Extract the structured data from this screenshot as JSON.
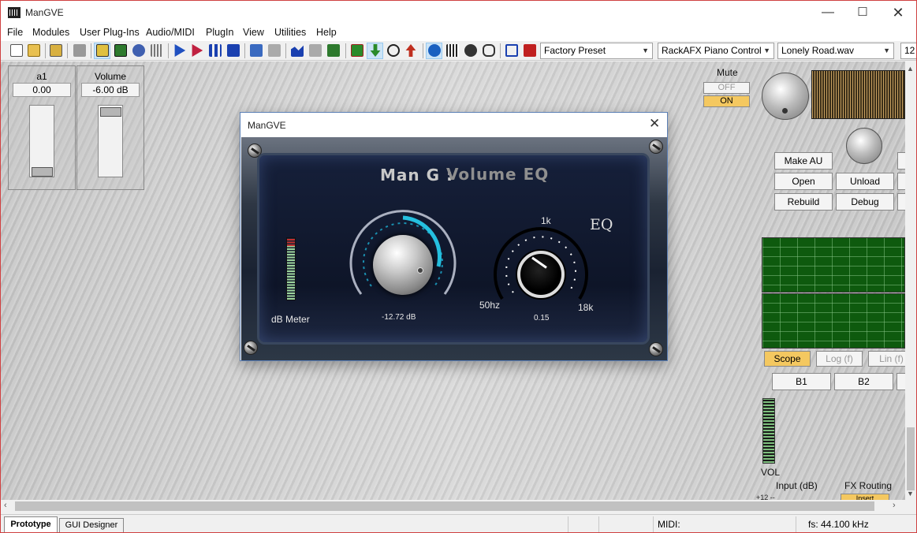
{
  "window": {
    "title": "ManGVE"
  },
  "menu": [
    "File",
    "Modules",
    "User Plug-Ins",
    "Audio/MIDI",
    "PlugIn",
    "View",
    "Utilities",
    "Help"
  ],
  "toolbar": {
    "preset": "Factory Preset",
    "controller": "RackAFX Piano Control",
    "audio_file": "Lonely Road.wav",
    "extra": "12"
  },
  "controls": [
    {
      "name": "a1",
      "value": "0.00",
      "slider_pos": 1.0
    },
    {
      "name": "Volume",
      "value": "-6.00 dB",
      "slider_pos": 0.0
    }
  ],
  "plugin": {
    "title": "ManGVE",
    "brand": "Man G :",
    "product": "Volume EQ",
    "eq_label": "EQ",
    "meter_label": "dB Meter",
    "volume_readout": "-12.72 dB",
    "freq_top": "1k",
    "freq_left": "50hz",
    "freq_right": "18k",
    "freq_readout": "0.15"
  },
  "right_panel": {
    "mute_label": "Mute",
    "mute_off": "OFF",
    "mute_on": "ON",
    "buttons": {
      "make_au": "Make AU",
      "open": "Open",
      "unload": "Unload",
      "rebuild": "Rebuild",
      "debug": "Debug"
    },
    "scope": "Scope",
    "log": "Log (f)",
    "lin": "Lin (f)",
    "b1": "B1",
    "b2": "B2",
    "vol": "VOL",
    "input_db": "Input (dB)",
    "fx_routing": "FX Routing",
    "plus12": "+12 --",
    "insert": "Insert"
  },
  "tabs": {
    "prototype": "Prototype",
    "gui_designer": "GUI Designer"
  },
  "status": {
    "midi": "MIDI:",
    "fs": "fs: 44.100 kHz"
  }
}
